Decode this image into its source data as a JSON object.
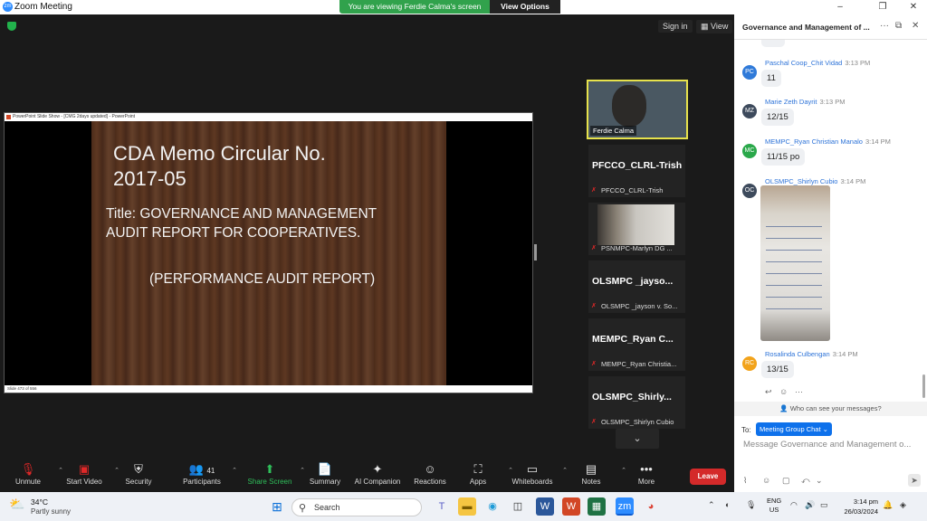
{
  "window": {
    "title": "Zoom Meeting",
    "minimize": "–",
    "maximize": "❐",
    "close": "✕"
  },
  "banner": {
    "message": "You are viewing Ferdie Calma's screen",
    "view_options": "View Options"
  },
  "meeting_top": {
    "sign_in": "Sign in",
    "view": "View"
  },
  "shared_screen": {
    "window_title": "PowerPoint Slide Show - [CMG 2days updated] - PowerPoint",
    "footer": "Slide 473 of 556",
    "slide": {
      "title_line1": "CDA Memo Circular No.",
      "title_line2": "2017-05",
      "body_line1": "Title: GOVERNANCE AND MANAGEMENT",
      "body_line2": "AUDIT REPORT FOR COOPERATIVES.",
      "body_line3": "(PERFORMANCE AUDIT REPORT)"
    }
  },
  "participants": [
    {
      "label": "Ferdie Calma"
    },
    {
      "name": "PFCCO_CLRL-Trish",
      "label": "PFCCO_CLRL-Trish"
    },
    {
      "label": "PSNMPC-Marlyn DG ..."
    },
    {
      "name": "OLSMPC _jayso...",
      "label": "OLSMPC _jayson v. So..."
    },
    {
      "name": "MEMPC_Ryan C...",
      "label": "MEMPC_Ryan Christia..."
    },
    {
      "name": "OLSMPC_Shirly...",
      "label": "OLSMPC_Shirlyn Cubio"
    }
  ],
  "toolbar": {
    "unmute": "Unmute",
    "start_video": "Start Video",
    "security": "Security",
    "participants": "Participants",
    "participant_count": "41",
    "share_screen": "Share Screen",
    "summary": "Summary",
    "ai_companion": "AI Companion",
    "reactions": "Reactions",
    "apps": "Apps",
    "whiteboards": "Whiteboards",
    "notes": "Notes",
    "more": "More",
    "leave": "Leave"
  },
  "chat": {
    "title": "Governance and Management of ...",
    "messages": [
      {
        "initials": "PC",
        "color": "#2f7ad9",
        "sender": "Paschal Coop_Chit Vidad",
        "time": "3:13 PM",
        "text": "11"
      },
      {
        "initials": "MZ",
        "color": "#3d4a5c",
        "sender": "Marie Zeth Dayrit",
        "time": "3:13 PM",
        "text": "12/15"
      },
      {
        "initials": "MC",
        "color": "#2aa84a",
        "sender": "MEMPC_Ryan Christian Manalo",
        "time": "3:14 PM",
        "text": "11/15 po"
      },
      {
        "initials": "OC",
        "color": "#3d4a5c",
        "sender": "OLSMPC_Shirlyn Cubio",
        "time": "3:14 PM",
        "text": ""
      },
      {
        "initials": "RC",
        "color": "#f2a31b",
        "sender": "Rosalinda Culbengan",
        "time": "3:14 PM",
        "text": "13/15"
      }
    ],
    "who_can_see": "Who can see your messages?",
    "to_label": "To:",
    "recipient": "Meeting Group Chat",
    "input_placeholder": "Message Governance and Management o..."
  },
  "taskbar": {
    "temperature": "34°C",
    "condition": "Partly sunny",
    "search": "Search",
    "lang": "ENG",
    "region": "US",
    "time": "3:14 pm",
    "date": "26/03/2024"
  }
}
